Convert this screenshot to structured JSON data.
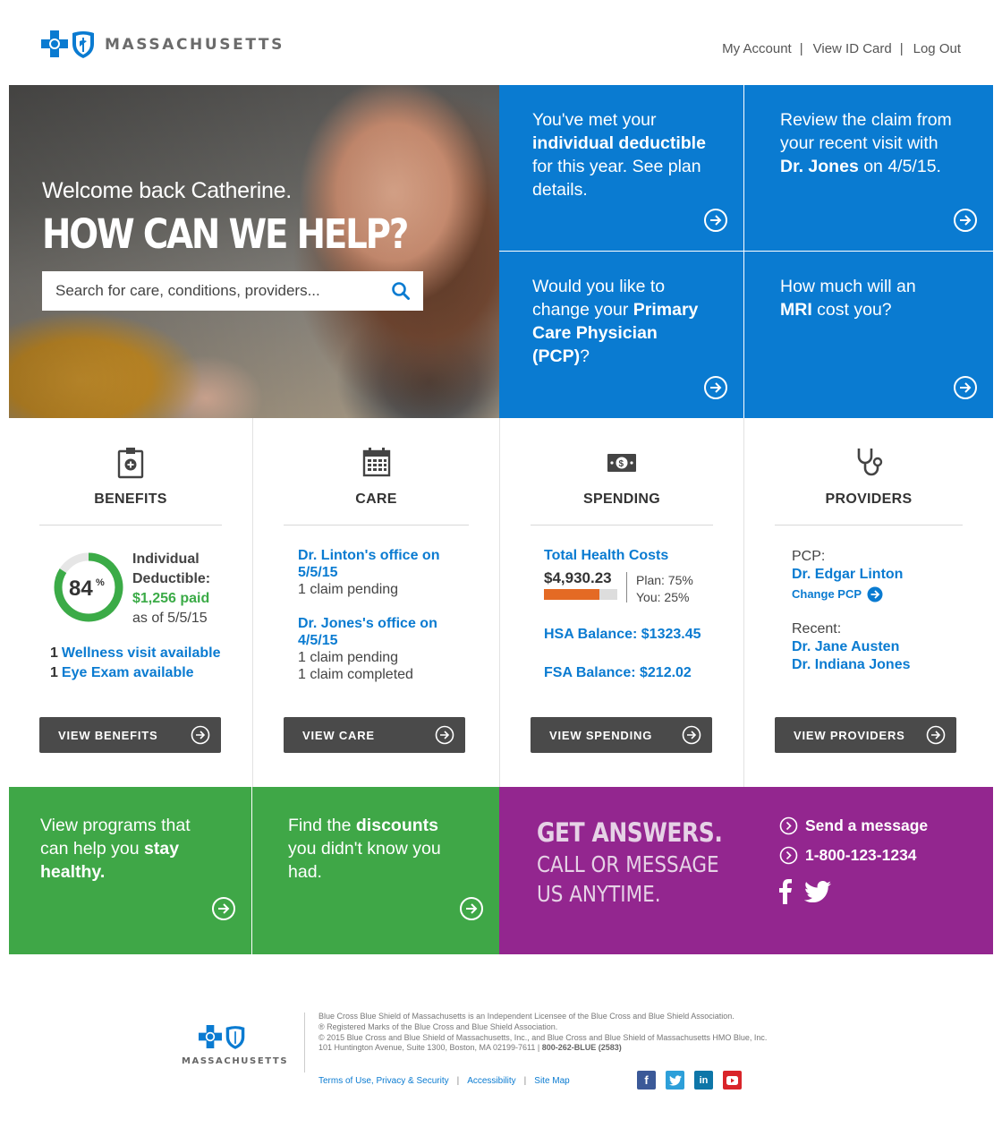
{
  "header": {
    "brand": "MASSACHUSETTS",
    "nav": [
      "My Account",
      "View ID Card",
      "Log Out"
    ]
  },
  "hero": {
    "welcome": "Welcome back Catherine.",
    "headline": "HOW CAN WE HELP?",
    "search_placeholder": "Search for care, conditions, providers..."
  },
  "tiles": [
    {
      "pre": "You've met your ",
      "bold": "individual deductible",
      "post": " for this year. See plan details."
    },
    {
      "pre": "Review the claim from your recent visit with ",
      "bold": "Dr. Jones",
      "post": " on 4/5/15."
    },
    {
      "pre": "Would you like to change your ",
      "bold": "Primary Care Physician (PCP)",
      "post": "?"
    },
    {
      "pre": "How much will an ",
      "bold": "MRI",
      "post": " cost you?"
    }
  ],
  "benefits": {
    "title": "BENEFITS",
    "percent": "84",
    "percent_sign": "%",
    "percent_value": 84,
    "label_line1": "Individual",
    "label_line2": "Deductible:",
    "paid": "$1,256 paid",
    "as_of": "as of 5/5/15",
    "avail": [
      {
        "count": "1",
        "label": "Wellness visit available"
      },
      {
        "count": "1",
        "label": "Eye Exam available"
      }
    ],
    "button": "VIEW BENEFITS"
  },
  "care": {
    "title": "CARE",
    "items": [
      {
        "office_line1": "Dr. Linton's office on",
        "office_line2": "5/5/15",
        "status": [
          "1 claim pending"
        ]
      },
      {
        "office_line1": "Dr. Jones's office on",
        "office_line2": "4/5/15",
        "status": [
          "1 claim pending",
          "1 claim completed"
        ]
      }
    ],
    "button": "VIEW CARE"
  },
  "spending": {
    "title": "SPENDING",
    "total_label": "Total Health Costs",
    "total_amount": "$4,930.23",
    "plan": "Plan: 75%",
    "you": "You: 25%",
    "plan_share": 0.75,
    "hsa": "HSA Balance: $1323.45",
    "fsa": "FSA Balance: $212.02",
    "button": "VIEW SPENDING"
  },
  "providers": {
    "title": "PROVIDERS",
    "pcp_label": "PCP:",
    "pcp_name": "Dr. Edgar Linton",
    "change_pcp": "Change PCP",
    "recent_label": "Recent:",
    "recent": [
      "Dr. Jane Austen",
      "Dr. Indiana Jones"
    ],
    "button": "VIEW PROVIDERS"
  },
  "promos": [
    {
      "pre": "View programs that can help you ",
      "bold": "stay healthy.",
      "post": ""
    },
    {
      "pre": "Find the ",
      "bold": "discounts",
      "post": " you didn't know you had."
    }
  ],
  "answers": {
    "headline": "GET ANSWERS.",
    "sub_line1": "CALL OR MESSAGE",
    "sub_line2": "US ANYTIME.",
    "send_message": "Send a message",
    "phone": "1-800-123-1234"
  },
  "footer": {
    "brand": "MASSACHUSETTS",
    "legal": [
      "Blue Cross Blue Shield of Massachusetts is an Independent Licensee of the Blue Cross and Blue Shield Association.",
      "® Registered Marks of the Blue Cross and Blue Shield Association.",
      "© 2015 Blue Cross and Blue Shield of Massachusetts, Inc., and Blue Cross and Blue Shield of Massachusetts HMO Blue, Inc."
    ],
    "address": "101 Huntington Avenue, Suite 1300, Boston, MA 02199-7611 | ",
    "phone": "800-262-BLUE (2583)",
    "links": [
      "Terms of Use, Privacy & Security",
      "Accessibility",
      "Site Map"
    ]
  },
  "colors": {
    "blue": "#0a7bd1",
    "green": "#3fa747",
    "purple": "#93268f",
    "dark_button": "#4a4a4a",
    "orange": "#e46a24"
  }
}
